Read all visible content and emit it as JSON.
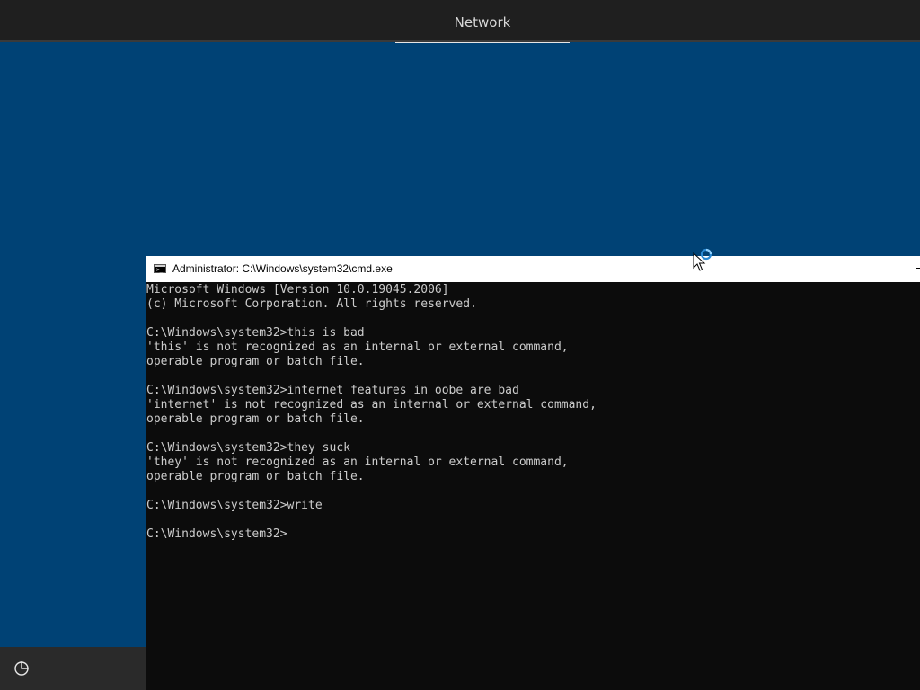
{
  "topbar": {
    "tab_label": "Network"
  },
  "cmd": {
    "title": "Administrator: C:\\Windows\\system32\\cmd.exe",
    "lines": [
      "Microsoft Windows [Version 10.0.19045.2006]",
      "(c) Microsoft Corporation. All rights reserved.",
      "",
      "C:\\Windows\\system32>this is bad",
      "'this' is not recognized as an internal or external command,",
      "operable program or batch file.",
      "",
      "C:\\Windows\\system32>internet features in oobe are bad",
      "'internet' is not recognized as an internal or external command,",
      "operable program or batch file.",
      "",
      "C:\\Windows\\system32>they suck",
      "'they' is not recognized as an internal or external command,",
      "operable program or batch file.",
      "",
      "C:\\Windows\\system32>write",
      "",
      "C:\\Windows\\system32>"
    ]
  },
  "icons": {
    "ease_of_access": "ease-of-access-icon",
    "cmd": "cmd-icon",
    "cursor": "mouse-pointer-busy-icon"
  },
  "colors": {
    "background": "#004275",
    "topbar": "#1f1f1f",
    "console_bg": "#0c0c0c",
    "console_text": "#cccccc",
    "busy_ring": "#2a8ad4"
  }
}
